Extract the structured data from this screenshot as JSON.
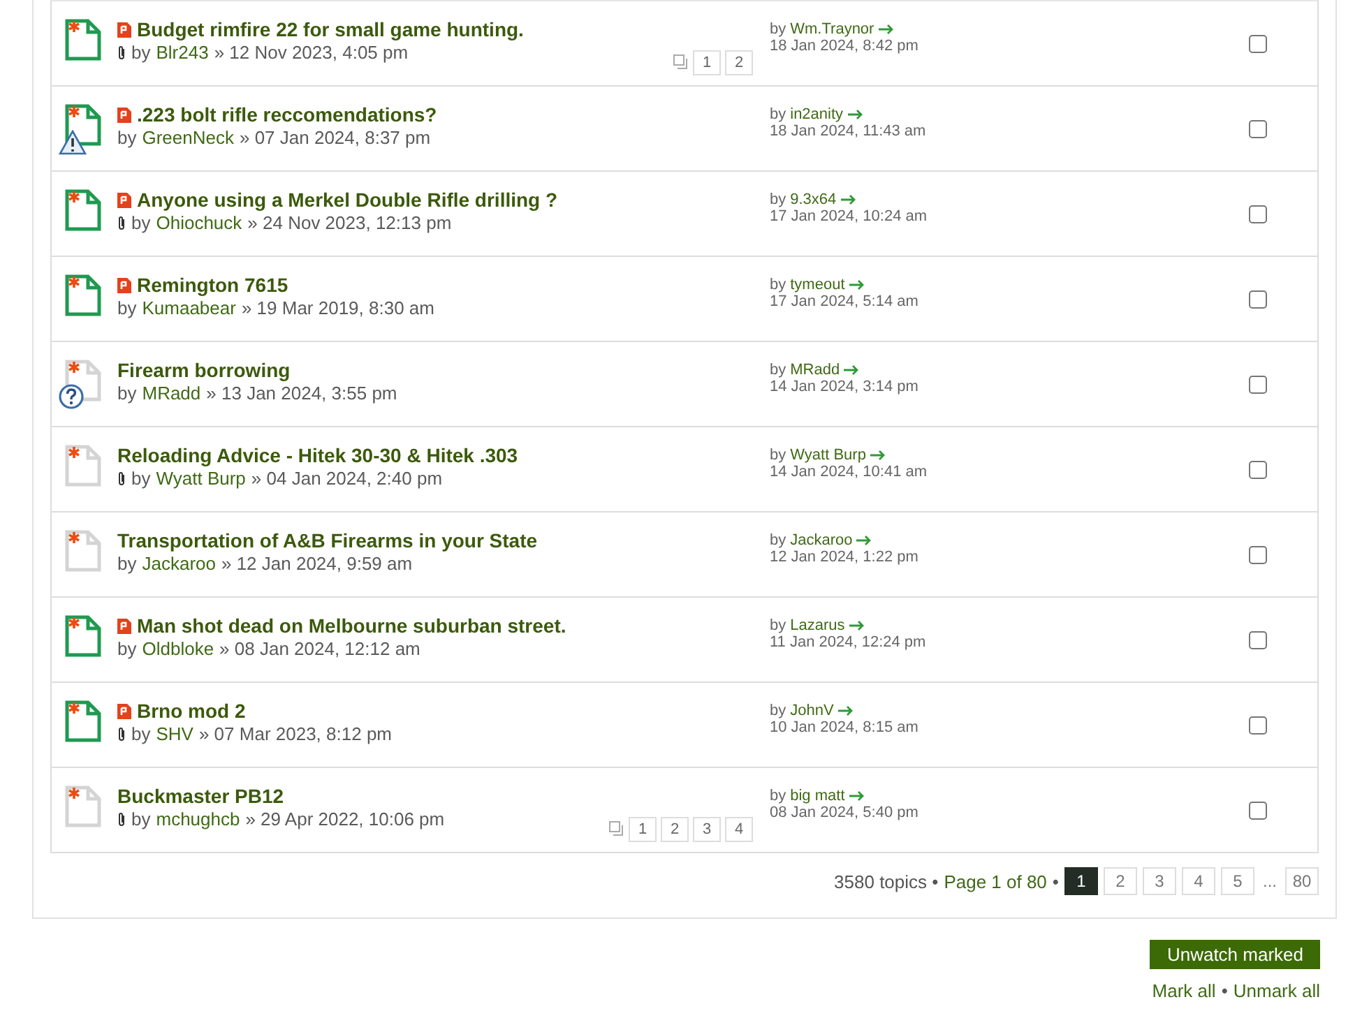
{
  "topics": [
    {
      "title": "Budget rimfire 22 for small game hunting.",
      "unread": true,
      "reported": true,
      "attachment": true,
      "kind": "plain",
      "by": "by",
      "author": "Blr243",
      "date": "» 12 Nov 2023, 4:05 pm",
      "pages": [
        "1",
        "2"
      ],
      "last_by": "by",
      "last_author": "Wm.Traynor",
      "last_date": "18 Jan 2024, 8:42 pm",
      "checked": false
    },
    {
      "title": ".223 bolt rifle reccomendations?",
      "unread": true,
      "reported": true,
      "attachment": false,
      "kind": "warning",
      "by": "by",
      "author": "GreenNeck",
      "date": "» 07 Jan 2024, 8:37 pm",
      "last_by": "by",
      "last_author": "in2anity",
      "last_date": "18 Jan 2024, 11:43 am",
      "checked": false
    },
    {
      "title": "Anyone using a Merkel Double Rifle drilling ?",
      "unread": true,
      "reported": true,
      "attachment": true,
      "kind": "plain",
      "by": "by",
      "author": "Ohiochuck",
      "date": "» 24 Nov 2023, 12:13 pm",
      "last_by": "by",
      "last_author": "9.3x64",
      "last_date": "17 Jan 2024, 10:24 am",
      "checked": false
    },
    {
      "title": "Remington 7615",
      "unread": true,
      "reported": true,
      "attachment": false,
      "kind": "plain",
      "by": "by",
      "author": "Kumaabear",
      "date": "» 19 Mar 2019, 8:30 am",
      "last_by": "by",
      "last_author": "tymeout",
      "last_date": "17 Jan 2024, 5:14 am",
      "checked": false
    },
    {
      "title": "Firearm borrowing",
      "unread": false,
      "reported": false,
      "attachment": false,
      "kind": "question",
      "by": "by",
      "author": "MRadd",
      "date": "» 13 Jan 2024, 3:55 pm",
      "last_by": "by",
      "last_author": "MRadd",
      "last_date": "14 Jan 2024, 3:14 pm",
      "checked": false
    },
    {
      "title": "Reloading Advice - Hitek 30-30 & Hitek .303",
      "unread": false,
      "reported": false,
      "attachment": true,
      "kind": "plain",
      "by": "by",
      "author": "Wyatt Burp",
      "date": "» 04 Jan 2024, 2:40 pm",
      "last_by": "by",
      "last_author": "Wyatt Burp",
      "last_date": "14 Jan 2024, 10:41 am",
      "checked": false
    },
    {
      "title": "Transportation of A&B Firearms in your State",
      "unread": false,
      "reported": false,
      "attachment": false,
      "kind": "plain",
      "by": "by",
      "author": "Jackaroo",
      "date": "» 12 Jan 2024, 9:59 am",
      "last_by": "by",
      "last_author": "Jackaroo",
      "last_date": "12 Jan 2024, 1:22 pm",
      "checked": false
    },
    {
      "title": "Man shot dead on Melbourne suburban street.",
      "unread": true,
      "reported": true,
      "attachment": false,
      "kind": "plain",
      "by": "by",
      "author": "Oldbloke",
      "date": "» 08 Jan 2024, 12:12 am",
      "last_by": "by",
      "last_author": "Lazarus",
      "last_date": "11 Jan 2024, 12:24 pm",
      "checked": false
    },
    {
      "title": "Brno mod 2",
      "unread": true,
      "reported": true,
      "attachment": true,
      "kind": "plain",
      "by": "by",
      "author": "SHV",
      "date": "» 07 Mar 2023, 8:12 pm",
      "last_by": "by",
      "last_author": "JohnV",
      "last_date": "10 Jan 2024, 8:15 am",
      "checked": false
    },
    {
      "title": "Buckmaster PB12",
      "unread": false,
      "reported": false,
      "attachment": true,
      "kind": "plain",
      "by": "by",
      "author": "mchughcb",
      "date": "» 29 Apr 2022, 10:06 pm",
      "pages": [
        "1",
        "2",
        "3",
        "4"
      ],
      "last_by": "by",
      "last_author": "big matt",
      "last_date": "08 Jan 2024, 5:40 pm",
      "checked": false
    }
  ],
  "pagination": {
    "count": "3580 topics •",
    "page_label": "Page 1 of 80",
    "separator": "•",
    "pages": [
      {
        "label": "1",
        "selected": true
      },
      {
        "label": "2",
        "selected": false
      },
      {
        "label": "3",
        "selected": false
      },
      {
        "label": "4",
        "selected": false
      },
      {
        "label": "5",
        "selected": false
      },
      {
        "label": "...",
        "kind": "ellipsis"
      },
      {
        "label": "80",
        "selected": false
      }
    ]
  },
  "actions": {
    "button": "Unwatch marked",
    "mark_all": "Mark all",
    "separator": "•",
    "unmark_all": "Unmark all"
  }
}
